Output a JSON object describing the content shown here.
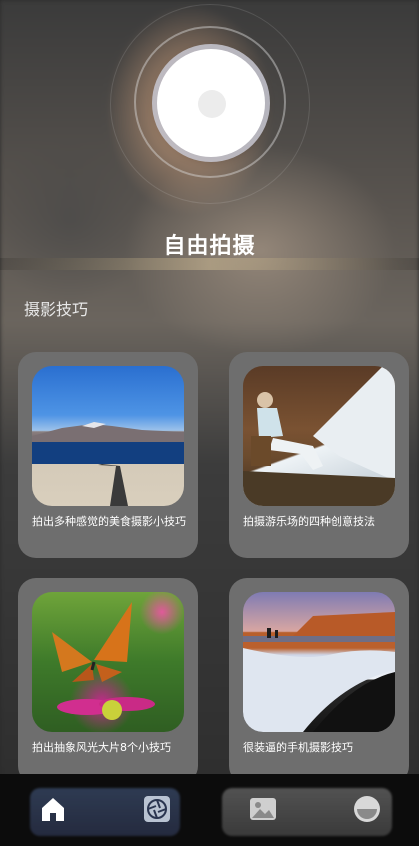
{
  "hero": {
    "title": "自由拍摄"
  },
  "section": {
    "title": "摄影技巧"
  },
  "cards": [
    {
      "caption": "拍出多种感觉的美食摄影小技巧",
      "image": "mountain-lake-road-photo"
    },
    {
      "caption": "拍摄游乐场的四种创意技法",
      "image": "woman-tent-camping-photo"
    },
    {
      "caption": "拍出抽象风光大片8个小技巧",
      "image": "butterfly-flower-photo"
    },
    {
      "caption": "很装逼的手机摄影技巧",
      "image": "beach-cliff-sunset-photo"
    }
  ],
  "nav": {
    "items": [
      {
        "icon": "home-icon",
        "active": true
      },
      {
        "icon": "camera-shutter-icon",
        "active": false
      },
      {
        "icon": "gallery-icon",
        "active": false
      },
      {
        "icon": "profile-icon",
        "active": false
      }
    ]
  }
}
